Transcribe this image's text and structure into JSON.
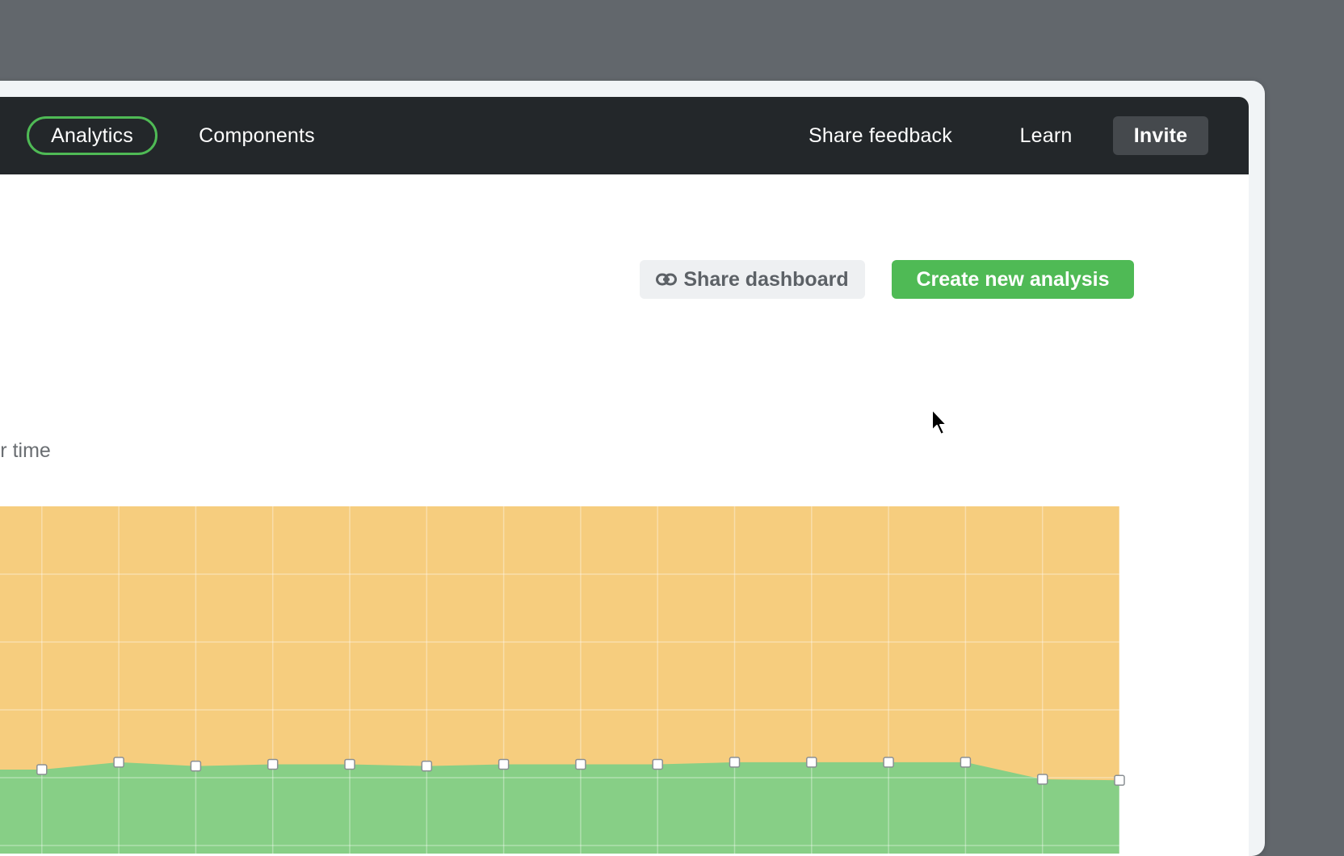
{
  "nav": {
    "analytics": "Analytics",
    "components": "Components",
    "share_feedback": "Share feedback",
    "learn": "Learn",
    "invite": "Invite"
  },
  "actions": {
    "share_dashboard": "Share dashboard",
    "create_new_analysis": "Create new analysis"
  },
  "chart_title": "over time",
  "icons": {
    "share": "link-icon"
  },
  "colors": {
    "accent": "#4fba55",
    "area_top": "#f6cd7e",
    "area_bottom": "#87cf86",
    "topbar": "#23272a"
  },
  "chart_data": {
    "type": "area",
    "grid": true,
    "legend": "none",
    "ylim": [
      0,
      100
    ],
    "series": [
      {
        "values": [
          100,
          100,
          100,
          100,
          100,
          100,
          100,
          100,
          100,
          100,
          100,
          100,
          100,
          100,
          100,
          100
        ]
      },
      {
        "values": [
          24.2,
          24.2,
          26.3,
          25.2,
          25.7,
          25.7,
          25.2,
          25.7,
          25.7,
          25.7,
          26.3,
          26.3,
          26.3,
          26.3,
          21.4,
          21.1
        ]
      }
    ]
  }
}
